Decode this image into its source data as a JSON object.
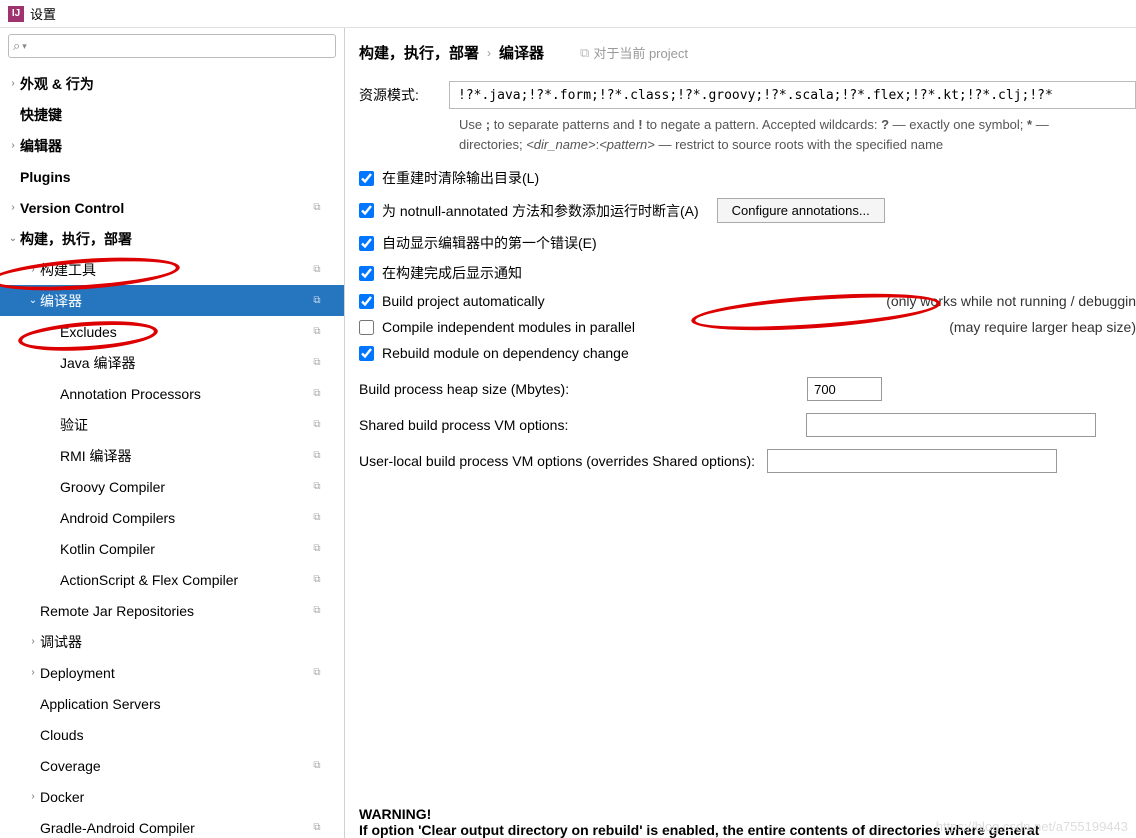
{
  "window": {
    "title": "设置"
  },
  "search": {
    "placeholder": ""
  },
  "tree": [
    {
      "label": "外观 & 行为",
      "indent": 0,
      "arrow": "›",
      "bold": true,
      "badge": ""
    },
    {
      "label": "快捷键",
      "indent": 0,
      "arrow": "",
      "bold": true,
      "badge": ""
    },
    {
      "label": "编辑器",
      "indent": 0,
      "arrow": "›",
      "bold": true,
      "badge": ""
    },
    {
      "label": "Plugins",
      "indent": 0,
      "arrow": "",
      "bold": true,
      "badge": ""
    },
    {
      "label": "Version Control",
      "indent": 0,
      "arrow": "›",
      "bold": true,
      "badge": "⧉"
    },
    {
      "label": "构建，执行，部署",
      "indent": 0,
      "arrow": "⌄",
      "bold": true,
      "badge": ""
    },
    {
      "label": "构建工具",
      "indent": 1,
      "arrow": "›",
      "bold": false,
      "badge": "⧉"
    },
    {
      "label": "编译器",
      "indent": 1,
      "arrow": "⌄",
      "bold": false,
      "badge": "⧉",
      "selected": true
    },
    {
      "label": "Excludes",
      "indent": 2,
      "arrow": "",
      "bold": false,
      "badge": "⧉"
    },
    {
      "label": "Java 编译器",
      "indent": 2,
      "arrow": "",
      "bold": false,
      "badge": "⧉"
    },
    {
      "label": "Annotation Processors",
      "indent": 2,
      "arrow": "",
      "bold": false,
      "badge": "⧉"
    },
    {
      "label": "验证",
      "indent": 2,
      "arrow": "",
      "bold": false,
      "badge": "⧉"
    },
    {
      "label": "RMI 编译器",
      "indent": 2,
      "arrow": "",
      "bold": false,
      "badge": "⧉"
    },
    {
      "label": "Groovy Compiler",
      "indent": 2,
      "arrow": "",
      "bold": false,
      "badge": "⧉"
    },
    {
      "label": "Android Compilers",
      "indent": 2,
      "arrow": "",
      "bold": false,
      "badge": "⧉"
    },
    {
      "label": "Kotlin Compiler",
      "indent": 2,
      "arrow": "",
      "bold": false,
      "badge": "⧉"
    },
    {
      "label": "ActionScript & Flex Compiler",
      "indent": 2,
      "arrow": "",
      "bold": false,
      "badge": "⧉"
    },
    {
      "label": "Remote Jar Repositories",
      "indent": 1,
      "arrow": "",
      "bold": false,
      "badge": "⧉"
    },
    {
      "label": "调试器",
      "indent": 1,
      "arrow": "›",
      "bold": false,
      "badge": ""
    },
    {
      "label": "Deployment",
      "indent": 1,
      "arrow": "›",
      "bold": false,
      "badge": "⧉"
    },
    {
      "label": "Application Servers",
      "indent": 1,
      "arrow": "",
      "bold": false,
      "badge": ""
    },
    {
      "label": "Clouds",
      "indent": 1,
      "arrow": "",
      "bold": false,
      "badge": ""
    },
    {
      "label": "Coverage",
      "indent": 1,
      "arrow": "",
      "bold": false,
      "badge": "⧉"
    },
    {
      "label": "Docker",
      "indent": 1,
      "arrow": "›",
      "bold": false,
      "badge": ""
    },
    {
      "label": "Gradle-Android Compiler",
      "indent": 1,
      "arrow": "",
      "bold": false,
      "badge": "⧉"
    }
  ],
  "breadcrumb": {
    "part1": "构建，执行，部署",
    "sep": "›",
    "part2": "编译器",
    "hint": "对于当前 project",
    "hint_icon": "⧉"
  },
  "resource": {
    "label": "资源模式:",
    "value": "!?*.java;!?*.form;!?*.class;!?*.groovy;!?*.scala;!?*.flex;!?*.kt;!?*.clj;!?*",
    "help1_a": "Use ",
    "help1_b": ";",
    "help1_c": " to separate patterns and ",
    "help1_d": "!",
    "help1_e": " to negate a pattern. Accepted wildcards: ",
    "help1_f": "?",
    "help1_g": " — exactly one symbol; ",
    "help1_h": "*",
    "help1_i": " —",
    "help2_a": "directories;  ",
    "help2_b": "<dir_name>",
    "help2_c": ":",
    "help2_d": "<pattern>",
    "help2_e": " — restrict to source roots with the specified name"
  },
  "checks": {
    "c1": "在重建时清除输出目录(L)",
    "c2": "为 notnull-annotated 方法和参数添加运行时断言(A)",
    "c2_btn": "Configure annotations...",
    "c3": "自动显示编辑器中的第一个错误(E)",
    "c4": "在构建完成后显示通知",
    "c5": "Build project automatically",
    "c5_note": "(only works while not running / debuggin",
    "c6": "Compile independent modules in parallel",
    "c6_note": "(may require larger heap size)",
    "c7": "Rebuild module on dependency change"
  },
  "fields": {
    "heap_label": "Build process heap size (Mbytes):",
    "heap_value": "700",
    "shared_label": "Shared build process VM options:",
    "shared_value": "",
    "user_label": "User-local build process VM options (overrides Shared options):",
    "user_value": ""
  },
  "warning": {
    "title": "WARNING!",
    "text": "If option 'Clear output directory on rebuild' is enabled, the entire contents of directories where generat"
  },
  "watermark": "https://blog.csdn.net/a755199443"
}
